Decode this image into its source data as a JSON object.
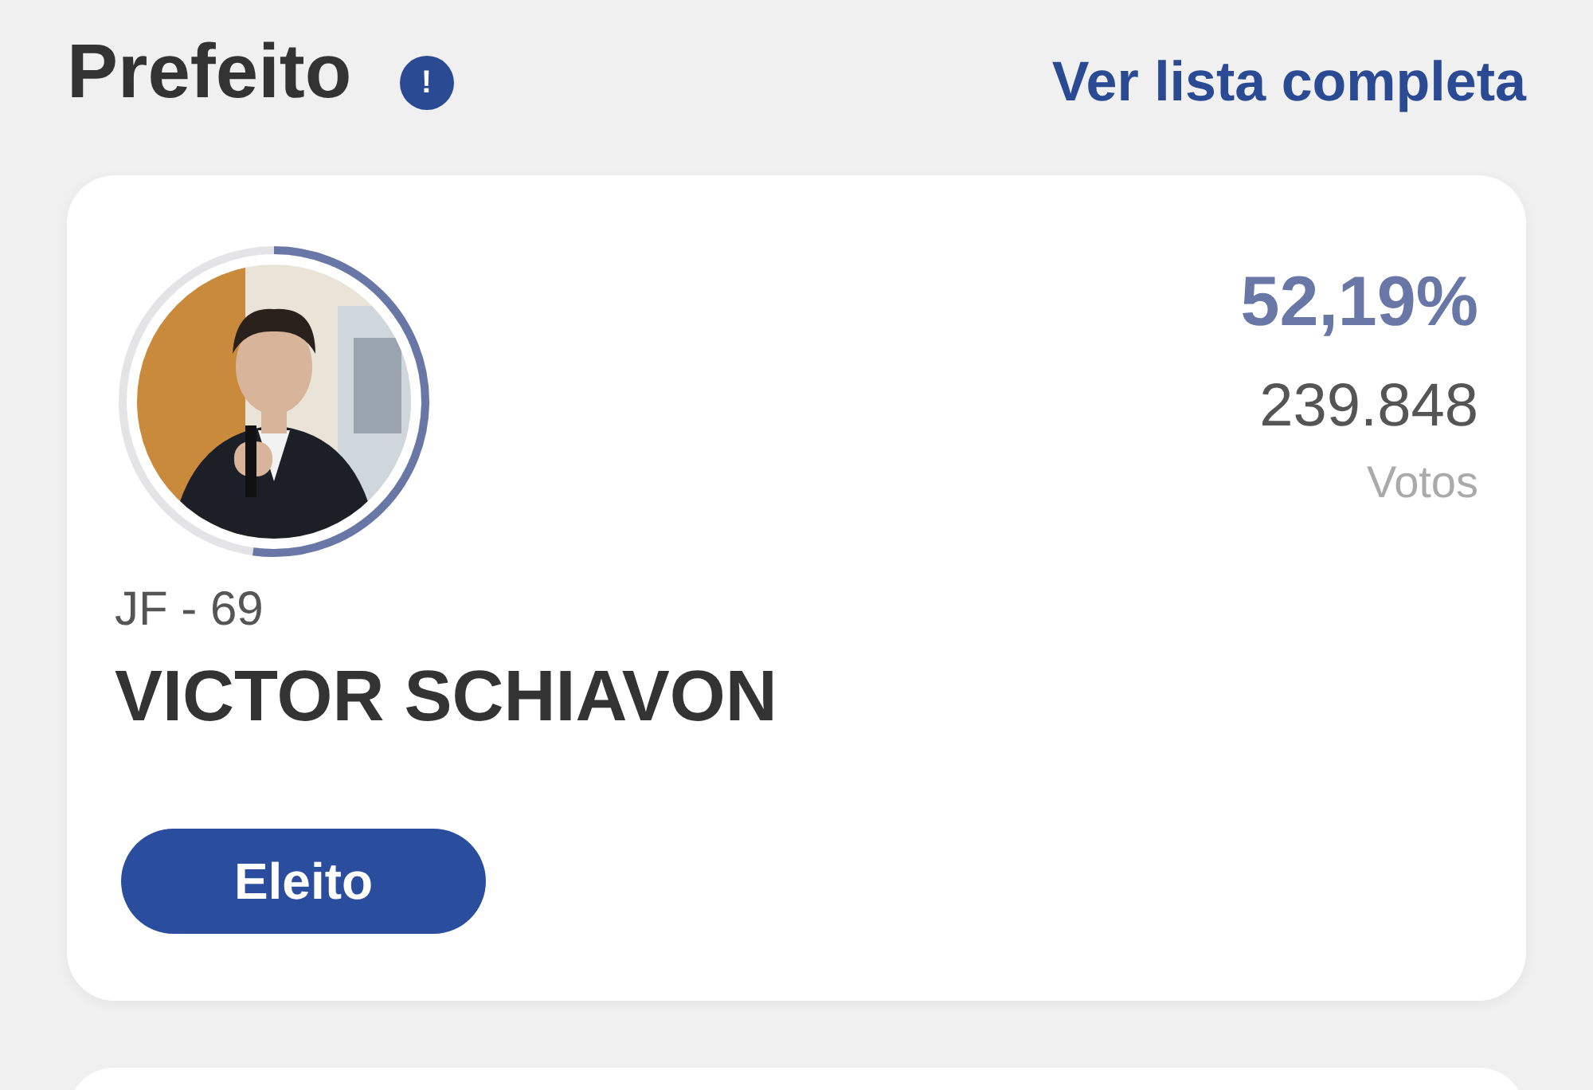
{
  "header": {
    "title": "Prefeito",
    "info_icon": "!",
    "link": "Ver lista completa"
  },
  "candidate": {
    "level": 0.5219,
    "code": "JF - 69",
    "name": "VICTOR SCHIAVON",
    "percent": "52,19%",
    "votes": "239.848",
    "votes_label": "Votos",
    "status": "Eleito"
  }
}
